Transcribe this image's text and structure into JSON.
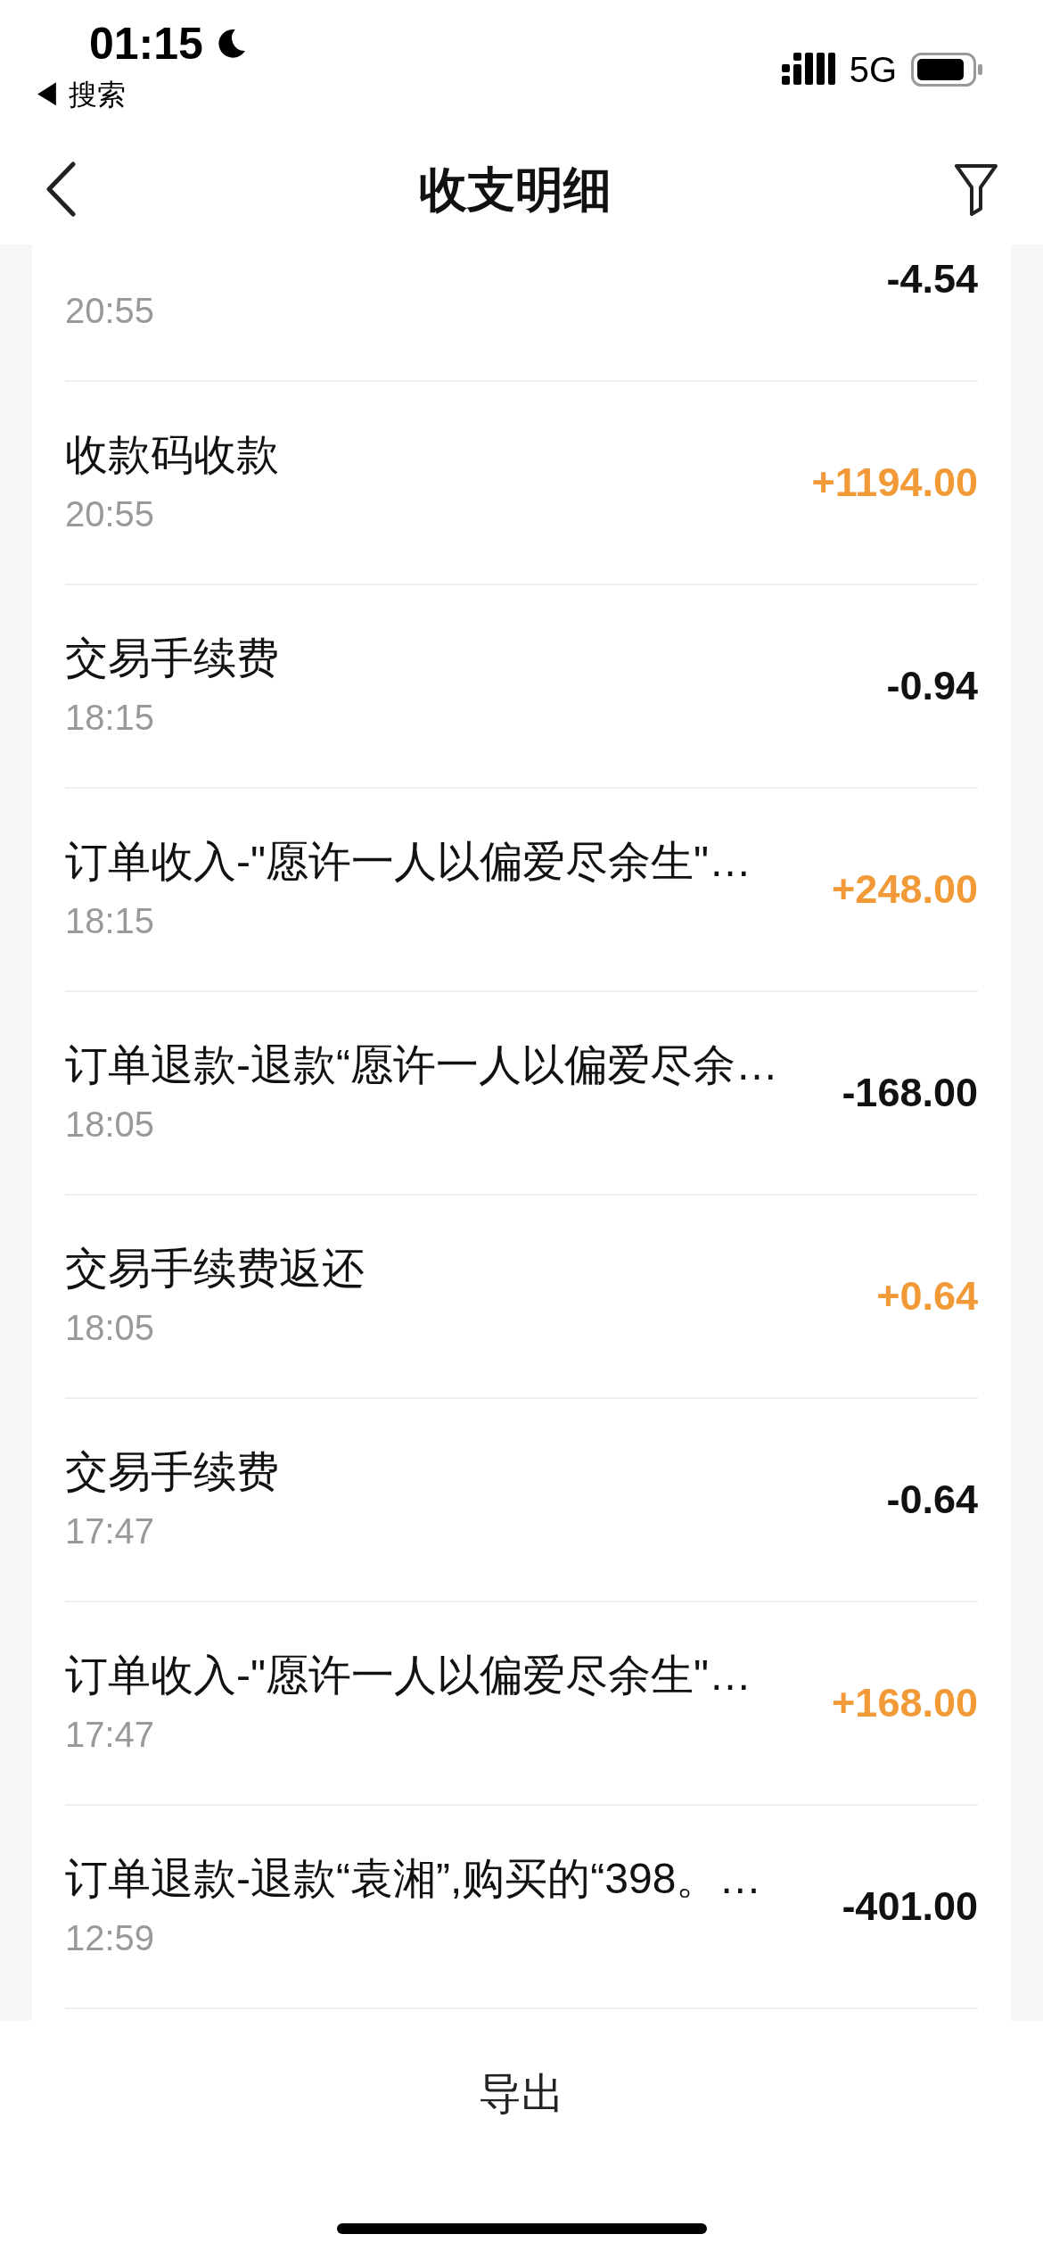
{
  "status_bar": {
    "time": "01:15",
    "back_label": "◀ 搜索",
    "network": "5G"
  },
  "nav": {
    "title": "收支明细"
  },
  "rows": [
    {
      "time": "20:55",
      "amount": "-4.54",
      "kind": "expense"
    },
    {
      "label": "收款码收款",
      "time": "20:55",
      "amount": "+1194.00",
      "kind": "income"
    },
    {
      "label": "交易手续费",
      "time": "18:15",
      "amount": "-0.94",
      "kind": "expense"
    },
    {
      "label": "订单收入-\"愿许一人以偏爱尽余生\"…",
      "time": "18:15",
      "amount": "+248.00",
      "kind": "income"
    },
    {
      "label": "订单退款-退款“愿许一人以偏爱尽余…",
      "time": "18:05",
      "amount": "-168.00",
      "kind": "expense"
    },
    {
      "label": "交易手续费返还",
      "time": "18:05",
      "amount": "+0.64",
      "kind": "income"
    },
    {
      "label": "交易手续费",
      "time": "17:47",
      "amount": "-0.64",
      "kind": "expense"
    },
    {
      "label": "订单收入-\"愿许一人以偏爱尽余生\"…",
      "time": "17:47",
      "amount": "+168.00",
      "kind": "income"
    },
    {
      "label": "订单退款-退款“袁湘”,购买的“398。…",
      "time": "12:59",
      "amount": "-401.00",
      "kind": "expense"
    }
  ],
  "export_button": "导出"
}
